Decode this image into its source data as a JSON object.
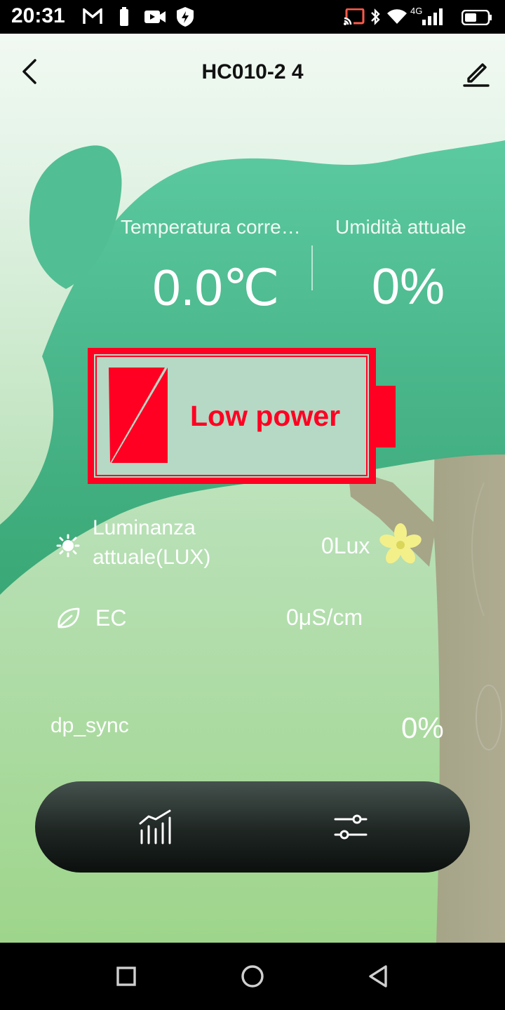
{
  "status_bar": {
    "time": "20:31",
    "network": "4G",
    "icons": [
      "gmail-icon",
      "battery-saver-icon",
      "video-icon",
      "shield-icon",
      "cast-icon",
      "bluetooth-icon",
      "wifi-icon",
      "signal-icon",
      "battery-icon"
    ]
  },
  "header": {
    "title": "HC010-2 4",
    "back_icon": "chevron-left-icon",
    "edit_icon": "pencil-icon"
  },
  "metrics": {
    "temperature": {
      "label": "Temperatura corre…",
      "value": "0.0℃"
    },
    "humidity": {
      "label": "Umidità attuale",
      "value": "0%"
    }
  },
  "battery": {
    "status_text": "Low power",
    "colors": {
      "frame": "#ff0022",
      "fill": "#b5d9c5"
    }
  },
  "readings": {
    "lux": {
      "label_line1": "Luminanza",
      "label_line2": "attuale(LUX)",
      "value": "0Lux",
      "icon": "sun-icon"
    },
    "ec": {
      "label": "EC",
      "value": "0μS/cm",
      "icon": "leaf-icon"
    },
    "dp_sync": {
      "label": "dp_sync",
      "value": "0%"
    }
  },
  "bottom_bar": {
    "tabs": [
      {
        "icon": "chart-icon"
      },
      {
        "icon": "sliders-icon"
      }
    ]
  },
  "nav_bar": {
    "buttons": [
      "recents-square-icon",
      "home-circle-icon",
      "back-triangle-icon"
    ]
  },
  "colors": {
    "canopy": "#4fbd8f",
    "trunk": "#a7a78a",
    "accent_flower": "#f3f08a"
  }
}
